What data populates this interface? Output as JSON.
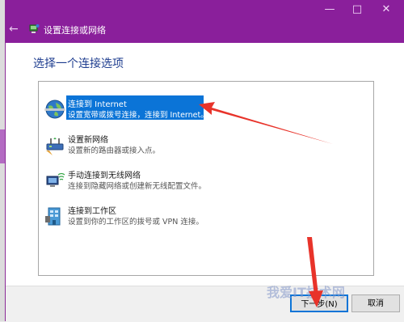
{
  "window": {
    "title": "设置连接或网络",
    "controls": {
      "minimize": "—",
      "maximize": "□",
      "close": "✕"
    },
    "back_symbol": "←"
  },
  "heading": "选择一个连接选项",
  "options": [
    {
      "title": "连接到 Internet",
      "desc": "设置宽带或拨号连接，连接到 Internet。",
      "selected": true,
      "icon": "globe-icon"
    },
    {
      "title": "设置新网络",
      "desc": "设置新的路由器或接入点。",
      "selected": false,
      "icon": "router-icon"
    },
    {
      "title": "手动连接到无线网络",
      "desc": "连接到隐藏网络或创建新无线配置文件。",
      "selected": false,
      "icon": "wireless-computer-icon"
    },
    {
      "title": "连接到工作区",
      "desc": "设置到你的工作区的拨号或 VPN 连接。",
      "selected": false,
      "icon": "workplace-icon"
    }
  ],
  "buttons": {
    "next": "下一步(N)",
    "cancel": "取消"
  },
  "watermark": "我爱IT技术网",
  "colors": {
    "titlebar": "#8a1f9b",
    "selection": "#0b74d7",
    "heading": "#1e3d8f",
    "arrow": "#e8332a"
  }
}
